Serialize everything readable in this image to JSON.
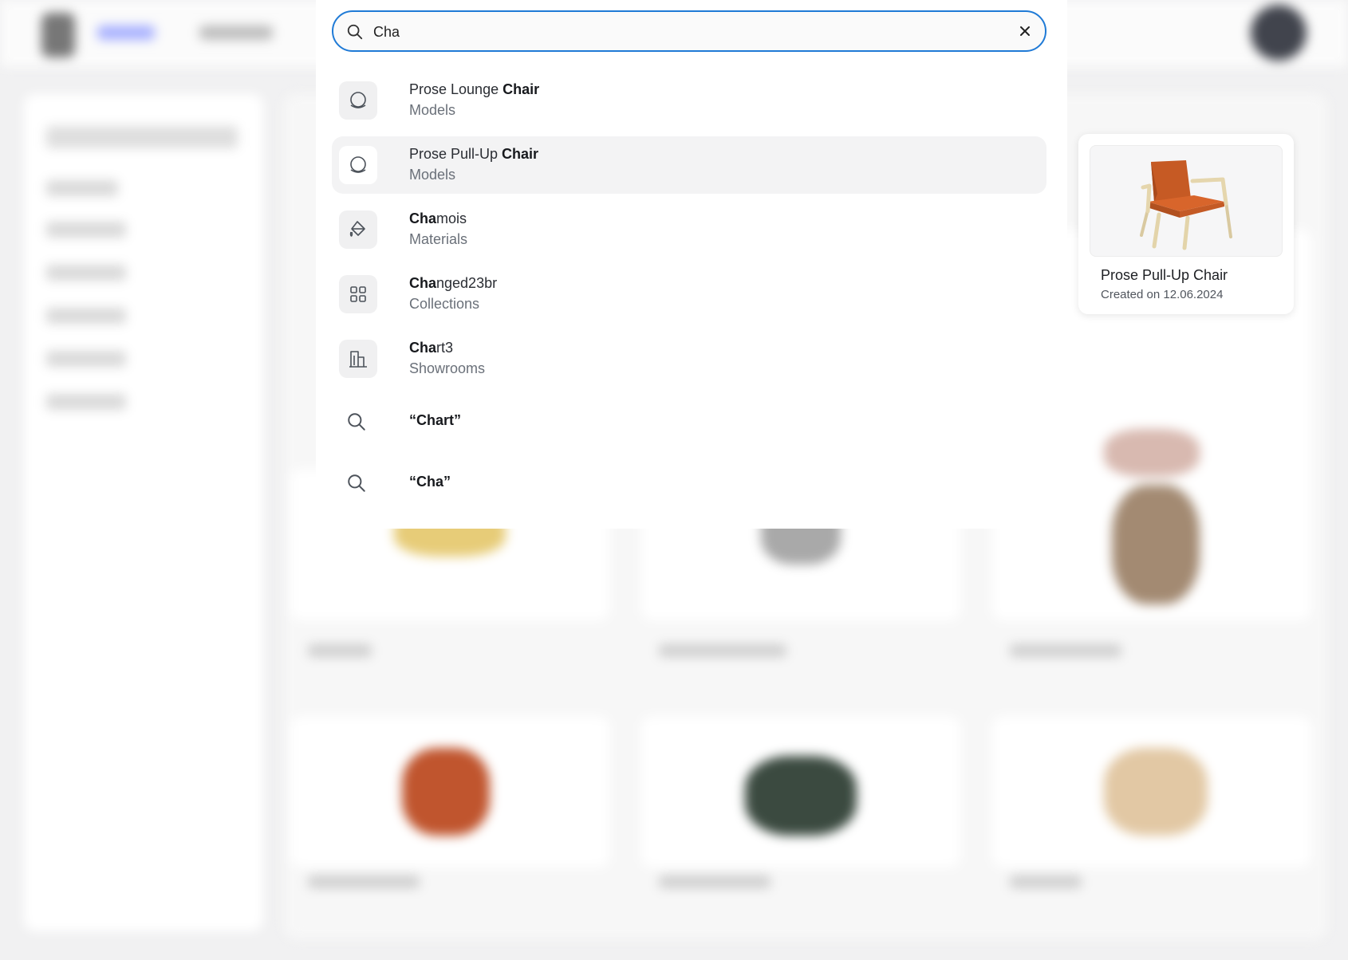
{
  "search": {
    "value": "Cha",
    "icon": "search-icon",
    "clear_icon": "close-icon",
    "accent_color": "#1f7ad6"
  },
  "results": [
    {
      "match": "",
      "title_before": "Prose Lounge ",
      "title_bold": "Chair",
      "title_after": "",
      "category": "Models",
      "icon": "circle-model-icon"
    },
    {
      "title_before": "Prose Pull-Up ",
      "title_bold": "Chair",
      "title_after": "",
      "category": "Models",
      "icon": "circle-model-icon",
      "active": true
    },
    {
      "title_before": "",
      "title_bold": "Cha",
      "title_after": "mois",
      "category": "Materials",
      "icon": "paint-bucket-icon"
    },
    {
      "title_before": "",
      "title_bold": "Cha",
      "title_after": "nged23br",
      "category": "Collections",
      "icon": "grid-icon"
    },
    {
      "title_before": "",
      "title_bold": "Cha",
      "title_after": "rt3",
      "category": "Showrooms",
      "icon": "building-icon"
    }
  ],
  "queries": [
    {
      "text": "“Chart”",
      "icon": "search-icon"
    },
    {
      "text": "“Cha”",
      "icon": "search-icon"
    }
  ],
  "preview": {
    "title": "Prose Pull-Up Chair",
    "created": "Created on 12.06.2024"
  }
}
